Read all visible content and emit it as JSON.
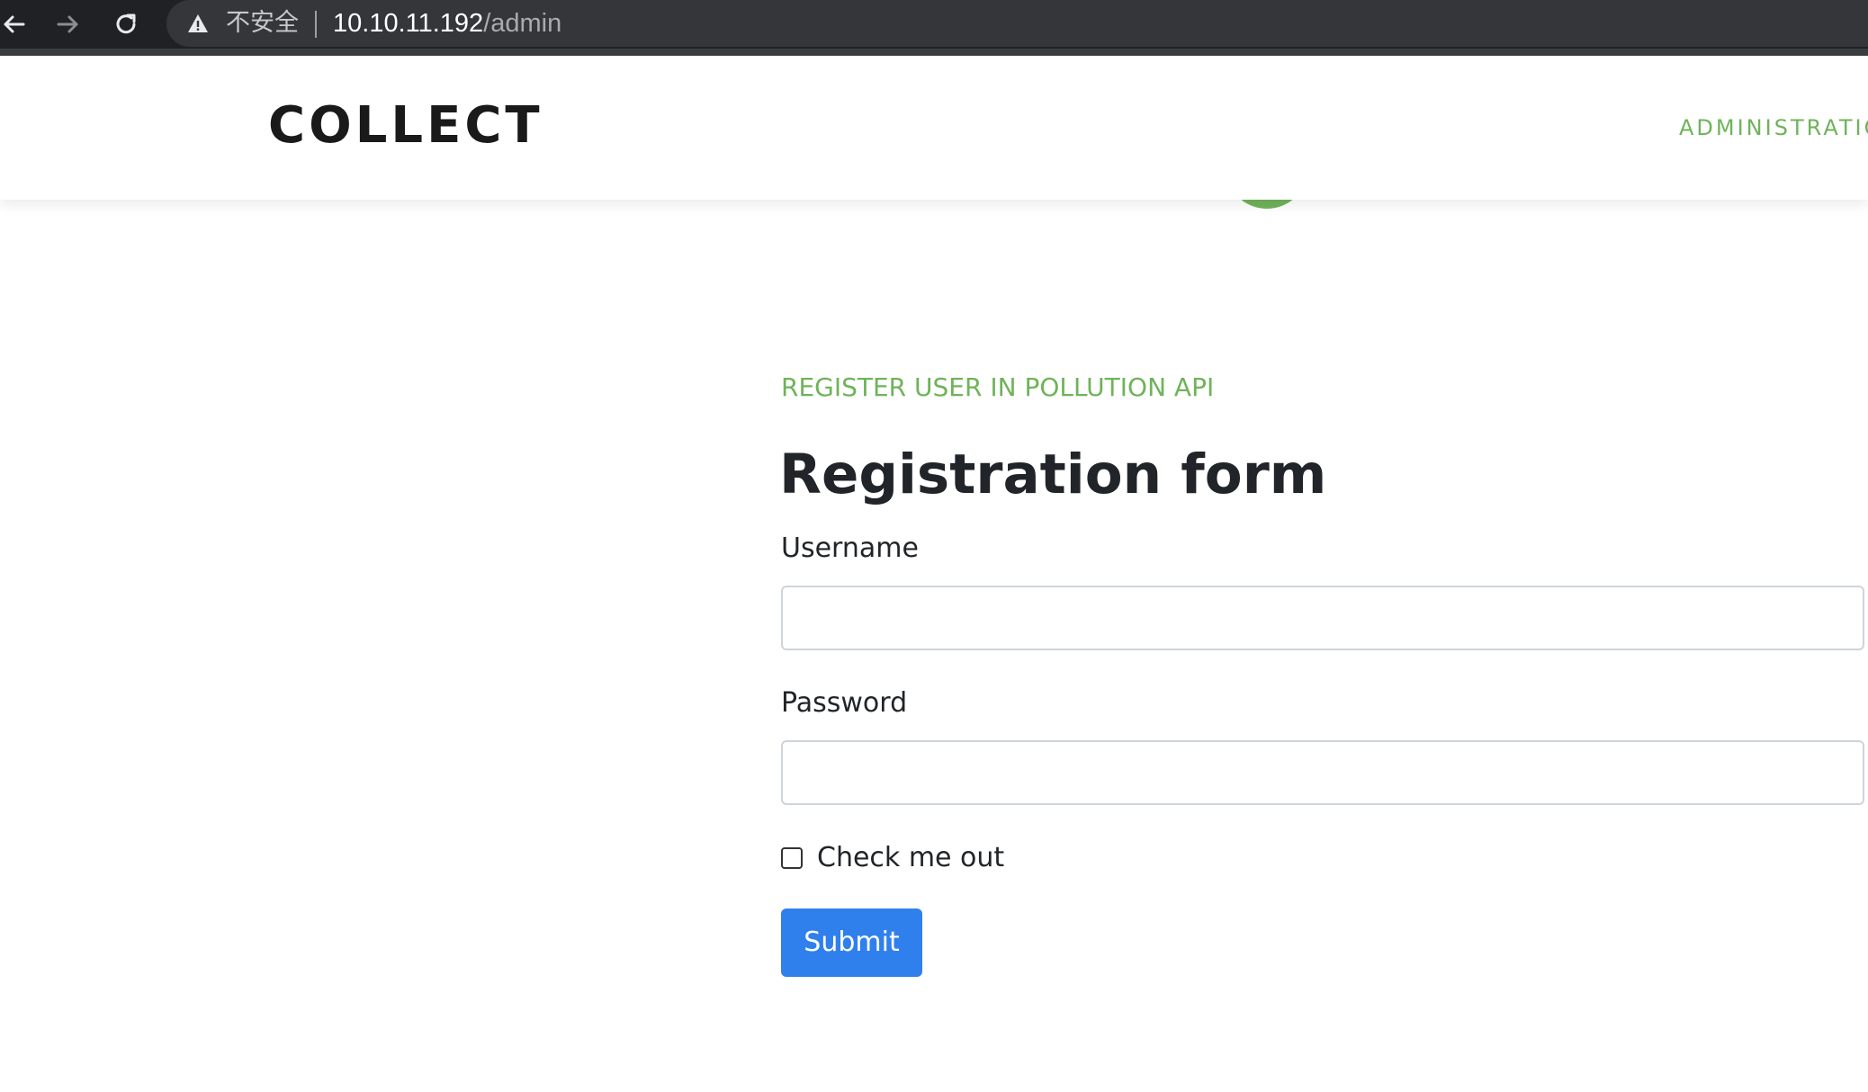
{
  "browser": {
    "security_label": "不安全",
    "url_host": "10.10.11.192",
    "url_path": "/admin"
  },
  "header": {
    "brand": "COLLECT",
    "nav_admin": "ADMINISTRATIO"
  },
  "form": {
    "eyebrow": "REGISTER USER IN POLLUTION API",
    "title": "Registration form",
    "username_label": "Username",
    "username_value": "",
    "password_label": "Password",
    "password_value": "",
    "checkbox_label": "Check me out",
    "checkbox_checked": false,
    "submit_label": "Submit"
  },
  "colors": {
    "accent_green": "#6fb35a",
    "submit_blue": "#2f80ed",
    "browser_dark": "#202124"
  }
}
